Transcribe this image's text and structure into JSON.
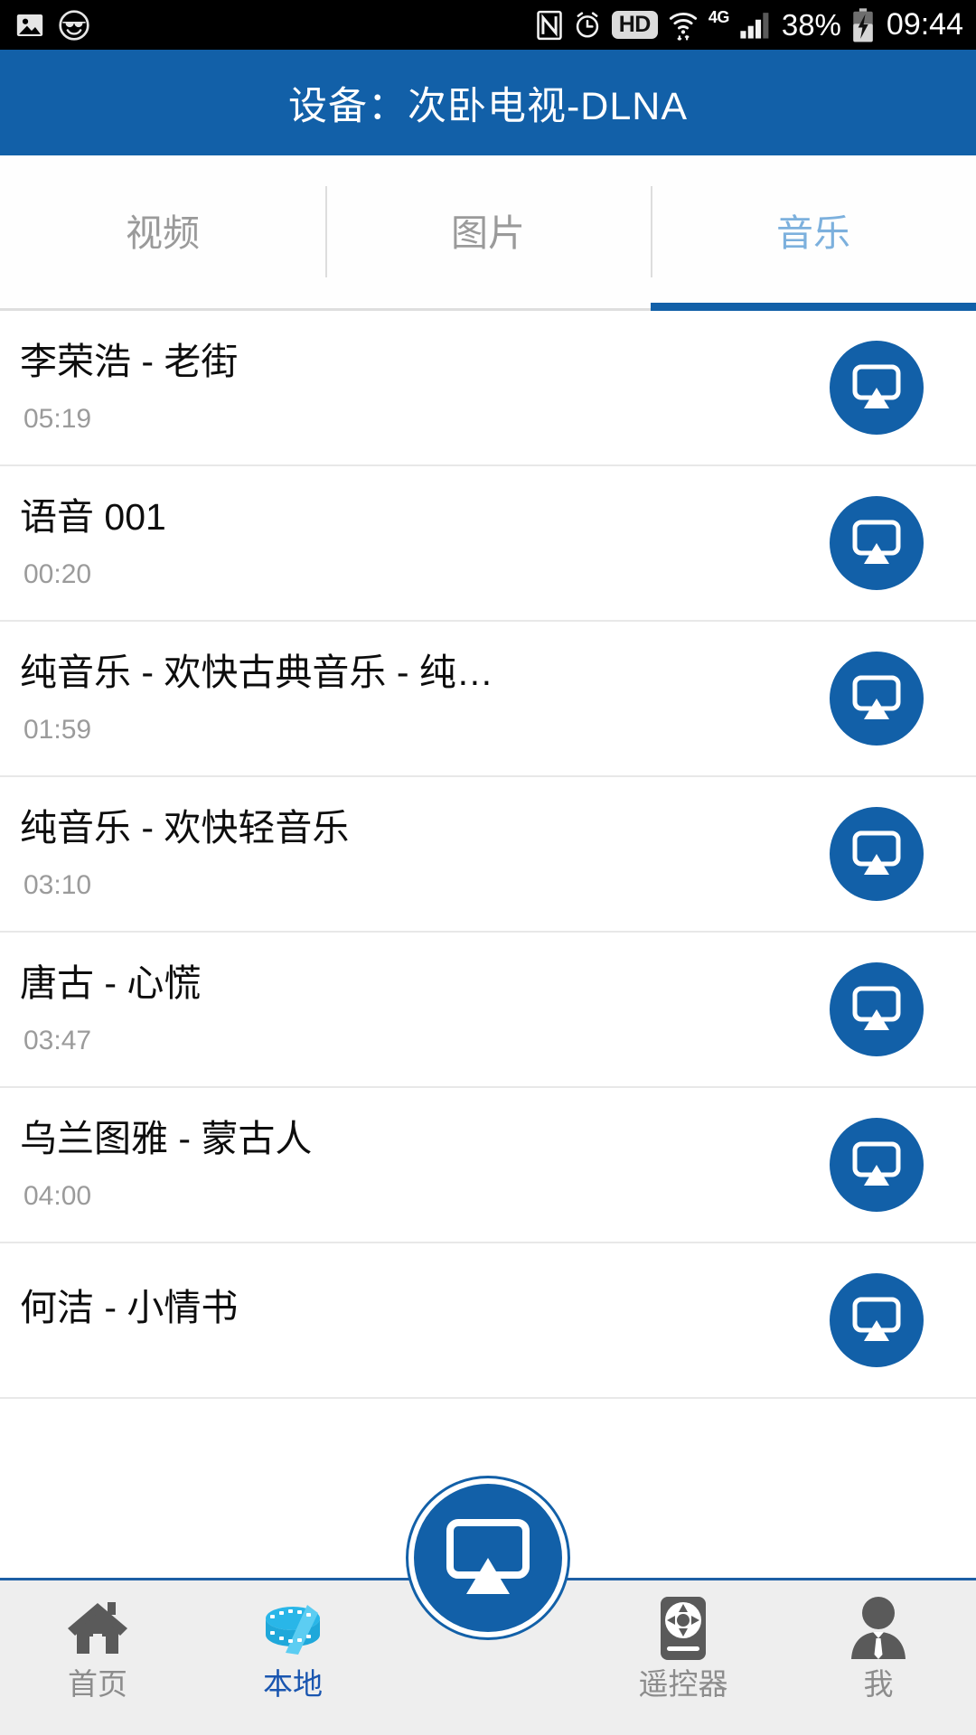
{
  "status_bar": {
    "left_icons": [
      "image-icon",
      "sunglasses-smiley-icon"
    ],
    "nfc_icon": "nfc-icon",
    "alarm_icon": "alarm-icon",
    "hd_badge": "HD",
    "wifi_icon": "wifi-icon",
    "network_type": "4G",
    "signal_icon": "signal-bars-icon",
    "battery_percent": "38%",
    "battery_icon": "battery-charging-icon",
    "clock": "09:44"
  },
  "appbar": {
    "title": "设备：次卧电视-DLNA"
  },
  "tabs": {
    "items": [
      {
        "label": "视频",
        "active": false
      },
      {
        "label": "图片",
        "active": false
      },
      {
        "label": "音乐",
        "active": true
      }
    ],
    "active_index": 2,
    "active_color": "#7cb0dd",
    "indicator_color": "#1260a8",
    "inactive_color": "#9a9a9a"
  },
  "list": {
    "cast_button_icon": "cast-airplay-icon",
    "items": [
      {
        "title": "李荣浩 - 老街",
        "duration": "05:19"
      },
      {
        "title": "语音 001",
        "duration": "00:20"
      },
      {
        "title": "纯音乐 - 欢快古典音乐 - 纯…",
        "duration": "01:59"
      },
      {
        "title": "纯音乐 - 欢快轻音乐",
        "duration": "03:10"
      },
      {
        "title": "唐古 - 心慌",
        "duration": "03:47"
      },
      {
        "title": "乌兰图雅 - 蒙古人",
        "duration": "04:00"
      },
      {
        "title": "何洁 - 小情书",
        "duration": ""
      }
    ]
  },
  "bottom_nav": {
    "items": [
      {
        "label": "首页",
        "icon": "home-icon",
        "active": false
      },
      {
        "label": "本地",
        "icon": "film-reel-icon",
        "active": true
      },
      {
        "label": "遥控器",
        "icon": "remote-control-icon",
        "active": false
      },
      {
        "label": "我",
        "icon": "user-icon",
        "active": false
      }
    ],
    "fab_icon": "cast-airplay-icon",
    "active_color": "#1a56b0",
    "inactive_color": "#8c8c8c"
  },
  "theme": {
    "primary": "#1260a8",
    "nav_background": "#eeeeee",
    "page_background": "#ffffff"
  }
}
